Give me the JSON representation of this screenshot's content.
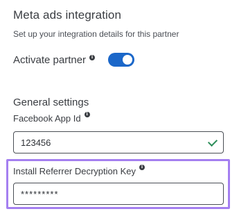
{
  "header": {
    "title": "Meta ads integration",
    "subtitle": "Set up your integration details for this partner"
  },
  "activate": {
    "label": "Activate partner",
    "info_icon": "info-icon",
    "toggle_on": true,
    "toggle_color": "#1b67c9"
  },
  "general_settings": {
    "heading": "General settings",
    "app_id": {
      "label": "Facebook App Id",
      "value": "123456",
      "status_icon": "check-icon",
      "status_color": "#2f8f5c"
    },
    "decryption_key": {
      "label": "Install Referrer Decryption Key",
      "value": "*********",
      "highlight_color": "#a47ff0"
    }
  }
}
